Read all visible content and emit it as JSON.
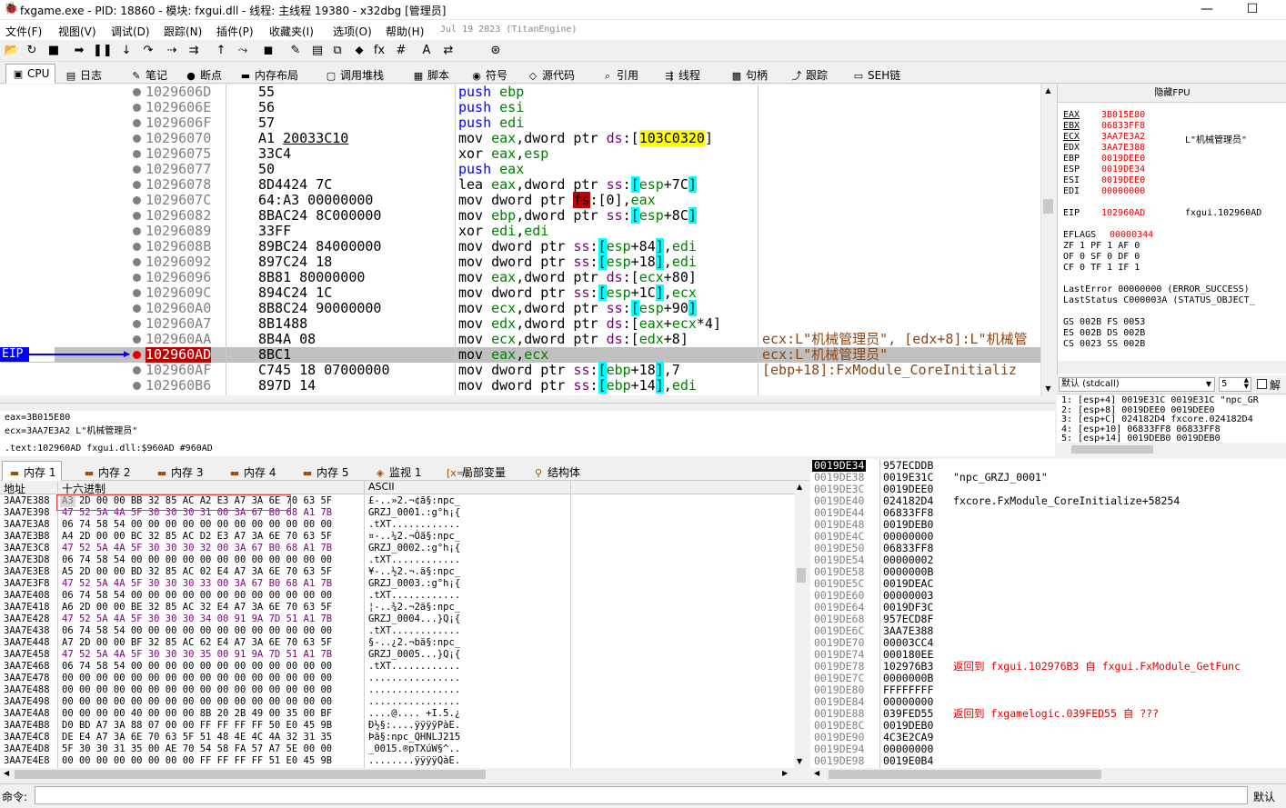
{
  "window": {
    "title": "fxgame.exe - PID: 18860 - 模块: fxgui.dll - 线程: 主线程 19380 - x32dbg [管理员]",
    "minimize": "—",
    "maximize": "☐"
  },
  "menu": {
    "items": [
      "文件(F)",
      "视图(V)",
      "调试(D)",
      "跟踪(N)",
      "插件(P)",
      "收藏夹(I)",
      "选项(O)",
      "帮助(H)"
    ],
    "build_date": "Jul 19 2023 (TitanEngine)"
  },
  "toolbar": {
    "icons": [
      "open-icon",
      "restart-icon",
      "stop-icon",
      "run-icon",
      "pause-icon",
      "step-into-icon",
      "step-over-icon",
      "trace-into-icon",
      "trace-over-icon",
      "execute-till-return-icon",
      "run-to-user-code-icon",
      "scylla-icon",
      "patch-icon",
      "comment-icon",
      "label-icon",
      "bookmark-icon",
      "function-icon",
      "hash-icon",
      "font-icon",
      "strings-icon",
      "about-icon"
    ],
    "glyphs": [
      "📂",
      "↻",
      "■",
      "➡",
      "❚❚",
      "↓",
      "↷",
      "⇢",
      "⇉",
      "↑",
      "⤳",
      "◼",
      "✎",
      "▤",
      "⧉",
      "⬥",
      "fx",
      "#",
      "A",
      "⇄",
      "⊛"
    ]
  },
  "tabs": [
    {
      "label": "CPU",
      "icon": "cpu-icon",
      "glyph": "▣",
      "active": true
    },
    {
      "label": "日志",
      "icon": "log-icon",
      "glyph": "▤"
    },
    {
      "label": "笔记",
      "icon": "notes-icon",
      "glyph": "✎"
    },
    {
      "label": "断点",
      "icon": "breakpoint-icon",
      "glyph": "●"
    },
    {
      "label": "内存布局",
      "icon": "memory-map-icon",
      "glyph": "▬"
    },
    {
      "label": "调用堆栈",
      "icon": "callstack-icon",
      "glyph": "▢"
    },
    {
      "label": "脚本",
      "icon": "script-icon",
      "glyph": "▦"
    },
    {
      "label": "符号",
      "icon": "symbol-icon",
      "glyph": "◉"
    },
    {
      "label": "源代码",
      "icon": "source-icon",
      "glyph": "◇"
    },
    {
      "label": "引用",
      "icon": "references-icon",
      "glyph": "⌕"
    },
    {
      "label": "线程",
      "icon": "threads-icon",
      "glyph": "⇶"
    },
    {
      "label": "句柄",
      "icon": "handles-icon",
      "glyph": "▩"
    },
    {
      "label": "跟踪",
      "icon": "trace-icon",
      "glyph": "⤴"
    },
    {
      "label": "SEH链",
      "icon": "seh-icon",
      "glyph": "▭"
    }
  ],
  "disasm": {
    "eip_label": "EIP",
    "rows": [
      {
        "addr": "1029606D",
        "bytes": "55",
        "instr": "<span class='kw-push'>push</span> <span class='reg'>ebp</span>",
        "cmt": ""
      },
      {
        "addr": "1029606E",
        "bytes": "56",
        "instr": "<span class='kw-push'>push</span> <span class='reg'>esi</span>",
        "cmt": ""
      },
      {
        "addr": "1029606F",
        "bytes": "57",
        "instr": "<span class='kw-push'>push</span> <span class='reg'>edi</span>",
        "cmt": ""
      },
      {
        "addr": "10296070",
        "bytes": "A1 <u>20033C10</u>",
        "instr": "mov <span class='reg'>eax</span>,dword ptr <span class='seg'>ds</span>:[<span class='hl'>103C0320</span>]",
        "cmt": ""
      },
      {
        "addr": "10296075",
        "bytes": "33C4",
        "instr": "xor <span class='reg'>eax</span>,<span class='reg'>esp</span>",
        "cmt": ""
      },
      {
        "addr": "10296077",
        "bytes": "50",
        "instr": "<span class='kw-push'>push</span> <span class='reg'>eax</span>",
        "cmt": ""
      },
      {
        "addr": "10296078",
        "bytes": "8D4424 7C",
        "instr": "lea <span class='reg'>eax</span>,dword ptr <span class='seg'>ss</span>:<span class='brk'>[</span><span class='reg'>esp</span>+7C<span class='brk'>]</span>",
        "cmt": ""
      },
      {
        "addr": "1029607C",
        "bytes": "64:A3 00000000",
        "instr": "mov dword ptr <span class='fsr'>fs</span>:[0],<span class='reg'>eax</span>",
        "cmt": ""
      },
      {
        "addr": "10296082",
        "bytes": "8BAC24 8C000000",
        "instr": "mov <span class='reg'>ebp</span>,dword ptr <span class='seg'>ss</span>:<span class='brk'>[</span><span class='reg'>esp</span>+8C<span class='brk'>]</span>",
        "cmt": ""
      },
      {
        "addr": "10296089",
        "bytes": "33FF",
        "instr": "xor <span class='reg'>edi</span>,<span class='reg'>edi</span>",
        "cmt": ""
      },
      {
        "addr": "1029608B",
        "bytes": "89BC24 84000000",
        "instr": "mov dword ptr <span class='seg'>ss</span>:<span class='brk'>[</span><span class='reg'>esp</span>+84<span class='brk'>]</span>,<span class='reg'>edi</span>",
        "cmt": ""
      },
      {
        "addr": "10296092",
        "bytes": "897C24 18",
        "instr": "mov dword ptr <span class='seg'>ss</span>:<span class='brk'>[</span><span class='reg'>esp</span>+18<span class='brk'>]</span>,<span class='reg'>edi</span>",
        "cmt": ""
      },
      {
        "addr": "10296096",
        "bytes": "8B81 80000000",
        "instr": "mov <span class='reg'>eax</span>,dword ptr <span class='seg'>ds</span>:[<span class='reg'>ecx</span>+80]",
        "cmt": ""
      },
      {
        "addr": "1029609C",
        "bytes": "894C24 1C",
        "instr": "mov dword ptr <span class='seg'>ss</span>:<span class='brk'>[</span><span class='reg'>esp</span>+1C<span class='brk'>]</span>,<span class='reg'>ecx</span>",
        "cmt": ""
      },
      {
        "addr": "102960A0",
        "bytes": "8B8C24 90000000",
        "instr": "mov <span class='reg'>ecx</span>,dword ptr <span class='seg'>ss</span>:<span class='brk'>[</span><span class='reg'>esp</span>+90<span class='brk'>]</span>",
        "cmt": ""
      },
      {
        "addr": "102960A7",
        "bytes": "8B1488",
        "instr": "mov <span class='reg'>edx</span>,dword ptr <span class='seg'>ds</span>:[<span class='reg'>eax</span>+<span class='reg'>ecx</span>*4]",
        "cmt": ""
      },
      {
        "addr": "102960AA",
        "bytes": "8B4A 08",
        "instr": "mov <span class='reg'>ecx</span>,dword ptr <span class='seg'>ds</span>:[<span class='reg'>edx</span>+8]",
        "cmt": "ecx:L\"机械管理员\", [edx+8]:L\"机械管"
      },
      {
        "addr": "102960AD",
        "bytes": "8BC1",
        "instr": "mov <span class='reg'>eax</span>,<span class='reg'>ecx</span>",
        "cmt": "ecx:L\"机械管理员\""
      },
      {
        "addr": "102960AF",
        "bytes": "C745 18 07000000",
        "instr": "mov dword ptr <span class='seg'>ss</span>:<span class='brk'>[</span><span class='reg'>ebp</span>+18<span class='brk'>]</span>,7",
        "cmt": "[ebp+18]:FxModule_CoreInitializ"
      },
      {
        "addr": "102960B6",
        "bytes": "897D 14",
        "instr": "mov dword ptr <span class='seg'>ss</span>:<span class='brk'>[</span><span class='reg'>ebp</span>+14<span class='brk'>]</span>,<span class='reg'>edi</span>",
        "cmt": ""
      }
    ]
  },
  "info": {
    "line1": "eax=3B015E80",
    "line2": "ecx=3AA7E3A2 L\"机械管理员\"",
    "line3": ".text:102960AD fxgui.dll:$960AD #960AD"
  },
  "registers": {
    "header": "隐藏FPU",
    "gp": [
      {
        "name": "EAX",
        "value": "3B015E80",
        "cmt": "",
        "changed": true
      },
      {
        "name": "EBX",
        "value": "06833FF8",
        "cmt": "",
        "changed": true
      },
      {
        "name": "ECX",
        "value": "3AA7E3A2",
        "cmt": "L\"机械管理员\"",
        "changed": true
      },
      {
        "name": "EDX",
        "value": "3AA7E388",
        "cmt": "",
        "changed": true
      },
      {
        "name": "EBP",
        "value": "0019DEE0",
        "cmt": "",
        "changed": true
      },
      {
        "name": "ESP",
        "value": "0019DE34",
        "cmt": "",
        "changed": true
      },
      {
        "name": "ESI",
        "value": "0019DEE0",
        "cmt": "",
        "changed": true
      },
      {
        "name": "EDI",
        "value": "00000000",
        "cmt": "",
        "changed": true
      }
    ],
    "eip": {
      "name": "EIP",
      "value": "102960AD",
      "cmt": "fxgui.102960AD"
    },
    "eflags": {
      "name": "EFLAGS",
      "value": "00000344"
    },
    "flags_line1": "ZF 1  PF 1  AF 0",
    "flags_line2": "OF 0  SF 0  DF 0",
    "flags_line3": "CF 0  TF 1  IF 1",
    "lasterror": "LastError  00000000 (ERROR_SUCCESS)",
    "laststatus": "LastStatus C000003A (STATUS_OBJECT_",
    "seg_line1": "GS 002B  FS 0053",
    "seg_line2": "ES 002B  DS 002B",
    "seg_line3": "CS 0023  SS 002B"
  },
  "callconv": {
    "selected": "默认 (stdcall)",
    "arg_count": "5",
    "unlock_label": "解锁"
  },
  "stack_args": [
    "1: [esp+4]  0019E31C 0019E31C \"npc_GR",
    "2: [esp+8]  0019DEE0 0019DEE0",
    "3: [esp+C]  024182D4 fxcore.024182D4",
    "4: [esp+10] 06833FF8 06833FF8",
    "5: [esp+14] 0019DEB0 0019DEB0"
  ],
  "bottom_tabs": [
    {
      "label": "内存 1",
      "icon": "memory-icon",
      "glyph": "▬",
      "active": true
    },
    {
      "label": "内存 2",
      "icon": "memory-icon",
      "glyph": "▬"
    },
    {
      "label": "内存 3",
      "icon": "memory-icon",
      "glyph": "▬"
    },
    {
      "label": "内存 4",
      "icon": "memory-icon",
      "glyph": "▬"
    },
    {
      "label": "内存 5",
      "icon": "memory-icon",
      "glyph": "▬"
    },
    {
      "label": "监视 1",
      "icon": "watch-icon",
      "glyph": "◈"
    },
    {
      "label": "局部变量",
      "icon": "locals-icon",
      "glyph": "[x=]"
    },
    {
      "label": "结构体",
      "icon": "struct-icon",
      "glyph": "⚲"
    }
  ],
  "dump": {
    "col_addr": "地址",
    "col_hex": "十六进制",
    "col_ascii": "ASCII",
    "rows": [
      {
        "a": "3AA7E388",
        "h": "A3 2D 00 00 BB 32 85 AC A2 E3 A7 3A 6E 70 63 5F",
        "s": "£-..»2.¬¢ã§:npc_"
      },
      {
        "a": "3AA7E398",
        "h": "47 52 5A 4A 5F 30 30 30 31 00 3A 67 B0 68 A1 7B",
        "s": "GRZJ_0001.:g°h¡{"
      },
      {
        "a": "3AA7E3A8",
        "h": "06 74 58 54 00 00 00 00 00 00 00 00 00 00 00 00",
        "s": ".tXT............"
      },
      {
        "a": "3AA7E3B8",
        "h": "A4 2D 00 00 BC 32 85 AC D2 E3 A7 3A 6E 70 63 5F",
        "s": "¤-..¼2.¬Òã§:npc_"
      },
      {
        "a": "3AA7E3C8",
        "h": "47 52 5A 4A 5F 30 30 30 32 00 3A 67 B0 68 A1 7B",
        "s": "GRZJ_0002.:g°h¡{"
      },
      {
        "a": "3AA7E3D8",
        "h": "06 74 58 54 00 00 00 00 00 00 00 00 00 00 00 00",
        "s": ".tXT............"
      },
      {
        "a": "3AA7E3E8",
        "h": "A5 2D 00 00 BD 32 85 AC 02 E4 A7 3A 6E 70 63 5F",
        "s": "¥-..½2.¬.ä§:npc_"
      },
      {
        "a": "3AA7E3F8",
        "h": "47 52 5A 4A 5F 30 30 30 33 00 3A 67 B0 68 A1 7B",
        "s": "GRZJ_0003.:g°h¡{"
      },
      {
        "a": "3AA7E408",
        "h": "06 74 58 54 00 00 00 00 00 00 00 00 00 00 00 00",
        "s": ".tXT............"
      },
      {
        "a": "3AA7E418",
        "h": "A6 2D 00 00 BE 32 85 AC 32 E4 A7 3A 6E 70 63 5F",
        "s": "¦-..¾2.¬2ä§:npc_"
      },
      {
        "a": "3AA7E428",
        "h": "47 52 5A 4A 5F 30 30 30 34 00 91 9A 7D 51 A1 7B",
        "s": "GRZJ_0004...}Q¡{"
      },
      {
        "a": "3AA7E438",
        "h": "06 74 58 54 00 00 00 00 00 00 00 00 00 00 00 00",
        "s": ".tXT............"
      },
      {
        "a": "3AA7E448",
        "h": "A7 2D 00 00 BF 32 85 AC 62 E4 A7 3A 6E 70 63 5F",
        "s": "§-..¿2.¬bä§:npc_"
      },
      {
        "a": "3AA7E458",
        "h": "47 52 5A 4A 5F 30 30 30 35 00 91 9A 7D 51 A1 7B",
        "s": "GRZJ_0005...}Q¡{"
      },
      {
        "a": "3AA7E468",
        "h": "06 74 58 54 00 00 00 00 00 00 00 00 00 00 00 00",
        "s": ".tXT............"
      },
      {
        "a": "3AA7E478",
        "h": "00 00 00 00 00 00 00 00 00 00 00 00 00 00 00 00",
        "s": "................"
      },
      {
        "a": "3AA7E488",
        "h": "00 00 00 00 00 00 00 00 00 00 00 00 00 00 00 00",
        "s": "................"
      },
      {
        "a": "3AA7E498",
        "h": "00 00 00 00 00 00 00 00 00 00 00 00 00 00 00 00",
        "s": "................"
      },
      {
        "a": "3AA7E4A8",
        "h": "00 00 00 00 40 00 00 00 8B 20 2B 49 00 35 00 BF",
        "s": "....@.... +I.5.¿"
      },
      {
        "a": "3AA7E4B8",
        "h": "D0 BD A7 3A 88 07 00 00 FF FF FF FF 50 E0 45 9B",
        "s": "Ð½§:....ÿÿÿÿPàE."
      },
      {
        "a": "3AA7E4C8",
        "h": "DE E4 A7 3A 6E 70 63 5F 51 48 4E 4C 4A 32 31 35",
        "s": "Þä§:npc_QHNLJ215"
      },
      {
        "a": "3AA7E4D8",
        "h": "5F 30 30 31 35 00 AE 70 54 58 FA 57 A7 5E 00 00",
        "s": "_0015.®pTXúW§^.."
      },
      {
        "a": "3AA7E4E8",
        "h": "00 00 00 00 00 00 00 00 FF FF FF FF 51 E0 45 9B",
        "s": "........ÿÿÿÿQàE."
      }
    ]
  },
  "stack": {
    "rows": [
      {
        "a": "0019DE34",
        "v": "957ECDDB",
        "c": "",
        "sel": true
      },
      {
        "a": "0019DE38",
        "v": "0019E31C",
        "c": "\"npc_GRZJ_0001\""
      },
      {
        "a": "0019DE3C",
        "v": "0019DEE0",
        "c": ""
      },
      {
        "a": "0019DE40",
        "v": "024182D4",
        "c": "fxcore.FxModule_CoreInitialize+58254"
      },
      {
        "a": "0019DE44",
        "v": "06833FF8",
        "c": ""
      },
      {
        "a": "0019DE48",
        "v": "0019DEB0",
        "c": ""
      },
      {
        "a": "0019DE4C",
        "v": "00000000",
        "c": ""
      },
      {
        "a": "0019DE50",
        "v": "06833FF8",
        "c": ""
      },
      {
        "a": "0019DE54",
        "v": "00000002",
        "c": ""
      },
      {
        "a": "0019DE58",
        "v": "0000000B",
        "c": ""
      },
      {
        "a": "0019DE5C",
        "v": "0019DEAC",
        "c": ""
      },
      {
        "a": "0019DE60",
        "v": "00000003",
        "c": ""
      },
      {
        "a": "0019DE64",
        "v": "0019DF3C",
        "c": ""
      },
      {
        "a": "0019DE68",
        "v": "957ECD8F",
        "c": ""
      },
      {
        "a": "0019DE6C",
        "v": "3AA7E388",
        "c": ""
      },
      {
        "a": "0019DE70",
        "v": "00003CC4",
        "c": ""
      },
      {
        "a": "0019DE74",
        "v": "000180EE",
        "c": ""
      },
      {
        "a": "0019DE78",
        "v": "102976B3",
        "c": "返回到 fxgui.102976B3 自 fxgui.FxModule_GetFunc",
        "ret": true
      },
      {
        "a": "0019DE7C",
        "v": "0000000B",
        "c": ""
      },
      {
        "a": "0019DE80",
        "v": "FFFFFFFF",
        "c": ""
      },
      {
        "a": "0019DE84",
        "v": "00000000",
        "c": ""
      },
      {
        "a": "0019DE88",
        "v": "039FED55",
        "c": "返回到 fxgamelogic.039FED55 自 ???",
        "ret": true
      },
      {
        "a": "0019DE8C",
        "v": "0019DEB0",
        "c": ""
      },
      {
        "a": "0019DE90",
        "v": "4C3E2CA9",
        "c": ""
      },
      {
        "a": "0019DE94",
        "v": "00000000",
        "c": ""
      },
      {
        "a": "0019DE98",
        "v": "0019E0B4",
        "c": ""
      }
    ]
  },
  "command": {
    "label": "命令:",
    "value": "",
    "mode": "默认"
  }
}
